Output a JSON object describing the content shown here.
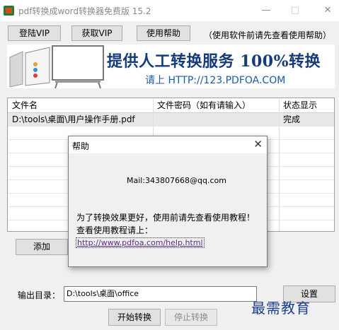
{
  "window": {
    "title": "pdf转换成word转换器免费版 15.2",
    "minimize": "—",
    "maximize": "□",
    "close": "✕"
  },
  "toolbar": {
    "login_vip": "登陆VIP",
    "get_vip": "获取VIP",
    "help": "使用帮助",
    "hint": "（使用软件前请先查看使用帮助）"
  },
  "banner": {
    "headline": "提供人工转换服务 100%转换",
    "sub": "请上 HTTP://123.PDFOA.COM"
  },
  "table": {
    "headers": [
      "文件名",
      "文件密码（如有请输入）",
      "状态显示"
    ],
    "rows": [
      {
        "file": "D:\\tools\\桌面\\用户操作手册.pdf",
        "password": "",
        "status": "完成"
      }
    ]
  },
  "actions": {
    "add": "添加"
  },
  "output": {
    "label": "输出目录：",
    "path": "D:\\tools\\桌面\\office",
    "settings": "设置",
    "start": "开始转换",
    "stop": "停止转换"
  },
  "watermark": "最需教育",
  "dialog": {
    "title": "帮助",
    "close": "✕",
    "mail": "Mail:343807668@qq.com",
    "line1": "为了转换效果更好，使用前请先查看使用教程！",
    "line2": "查看使用教程请上：",
    "link": "http://www.pdfoa.com/help.html"
  }
}
